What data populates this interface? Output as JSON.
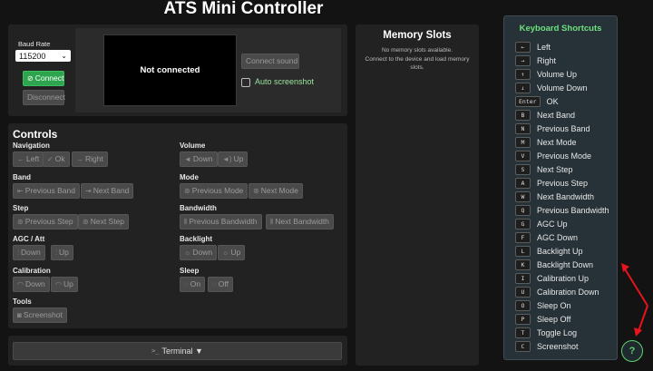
{
  "title": "ATS Mini Controller",
  "connection": {
    "baud_label": "Baud Rate",
    "baud_value": "115200",
    "connect_label": "Connect",
    "disconnect_label": "Disconnect",
    "screen_text": "Not connected",
    "connect_sound_label": "Connect sound",
    "auto_screenshot_label": "Auto screenshot"
  },
  "controls": {
    "heading": "Controls",
    "groups": [
      {
        "label": "Navigation",
        "buttons": [
          {
            "icon": "←",
            "label": "Left"
          },
          {
            "icon": "✓",
            "label": "Ok"
          },
          {
            "icon": "→",
            "label": "Right"
          }
        ]
      },
      {
        "label": "Volume",
        "buttons": [
          {
            "icon": "◄",
            "label": "Down"
          },
          {
            "icon": "◄)",
            "label": "Up"
          }
        ]
      },
      {
        "label": "Band",
        "buttons": [
          {
            "icon": "⇤",
            "label": "Previous Band"
          },
          {
            "icon": "⇥",
            "label": "Next Band"
          }
        ]
      },
      {
        "label": "Mode",
        "buttons": [
          {
            "icon": "⊛",
            "label": "Previous Mode"
          },
          {
            "icon": "⊛",
            "label": "Next Mode"
          }
        ]
      },
      {
        "label": "Step",
        "buttons": [
          {
            "icon": "⊛",
            "label": "Previous Step"
          },
          {
            "icon": "⊛",
            "label": "Next Step"
          }
        ]
      },
      {
        "label": "Bandwidth",
        "buttons": [
          {
            "icon": "⫴",
            "label": "Previous Bandwidth"
          },
          {
            "icon": "⫴",
            "label": "Next Bandwidth"
          }
        ]
      },
      {
        "label": "AGC / Att",
        "buttons": [
          {
            "icon": "⫶",
            "label": "Down"
          },
          {
            "icon": "⫶",
            "label": "Up"
          }
        ]
      },
      {
        "label": "Backlight",
        "buttons": [
          {
            "icon": "☼",
            "label": "Down"
          },
          {
            "icon": "☼",
            "label": "Up"
          }
        ]
      },
      {
        "label": "Calibration",
        "buttons": [
          {
            "icon": "◠",
            "label": "Down"
          },
          {
            "icon": "◠",
            "label": "Up"
          }
        ]
      },
      {
        "label": "Sleep",
        "buttons": [
          {
            "icon": "◌",
            "label": "On"
          },
          {
            "icon": "◌",
            "label": "Off"
          }
        ]
      },
      {
        "label": "Tools",
        "buttons": [
          {
            "icon": "◙",
            "label": "Screenshot"
          }
        ]
      }
    ]
  },
  "memory": {
    "heading": "Memory Slots",
    "empty_text": "No memory slots available.",
    "hint_text": "Connect to the device and load memory slots."
  },
  "terminal": {
    "icon": ">_",
    "label": "Terminal ▼"
  },
  "shortcuts": {
    "title": "Keyboard Shortcuts",
    "items": [
      {
        "key": "←",
        "desc": "Left"
      },
      {
        "key": "→",
        "desc": "Right"
      },
      {
        "key": "↑",
        "desc": "Volume Up"
      },
      {
        "key": "↓",
        "desc": "Volume Down"
      },
      {
        "key": "Enter",
        "desc": "OK"
      },
      {
        "key": "B",
        "desc": "Next Band"
      },
      {
        "key": "N",
        "desc": "Previous Band"
      },
      {
        "key": "M",
        "desc": "Next Mode"
      },
      {
        "key": "V",
        "desc": "Previous Mode"
      },
      {
        "key": "S",
        "desc": "Next Step"
      },
      {
        "key": "A",
        "desc": "Previous Step"
      },
      {
        "key": "W",
        "desc": "Next Bandwidth"
      },
      {
        "key": "Q",
        "desc": "Previous Bandwidth"
      },
      {
        "key": "G",
        "desc": "AGC Up"
      },
      {
        "key": "F",
        "desc": "AGC Down"
      },
      {
        "key": "L",
        "desc": "Backlight Up"
      },
      {
        "key": "K",
        "desc": "Backlight Down"
      },
      {
        "key": "I",
        "desc": "Calibration Up"
      },
      {
        "key": "U",
        "desc": "Calibration Down"
      },
      {
        "key": "O",
        "desc": "Sleep On"
      },
      {
        "key": "P",
        "desc": "Sleep Off"
      },
      {
        "key": "T",
        "desc": "Toggle Log"
      },
      {
        "key": "C",
        "desc": "Screenshot"
      }
    ]
  },
  "help": {
    "icon": "?"
  },
  "colors": {
    "accent_green": "#2ea44f",
    "shortcut_title": "#6ee07e",
    "annotation_red": "#e8141b"
  },
  "icons": {
    "help": "help-circle-icon",
    "terminal": "terminal-icon",
    "connect": "plug-icon"
  }
}
